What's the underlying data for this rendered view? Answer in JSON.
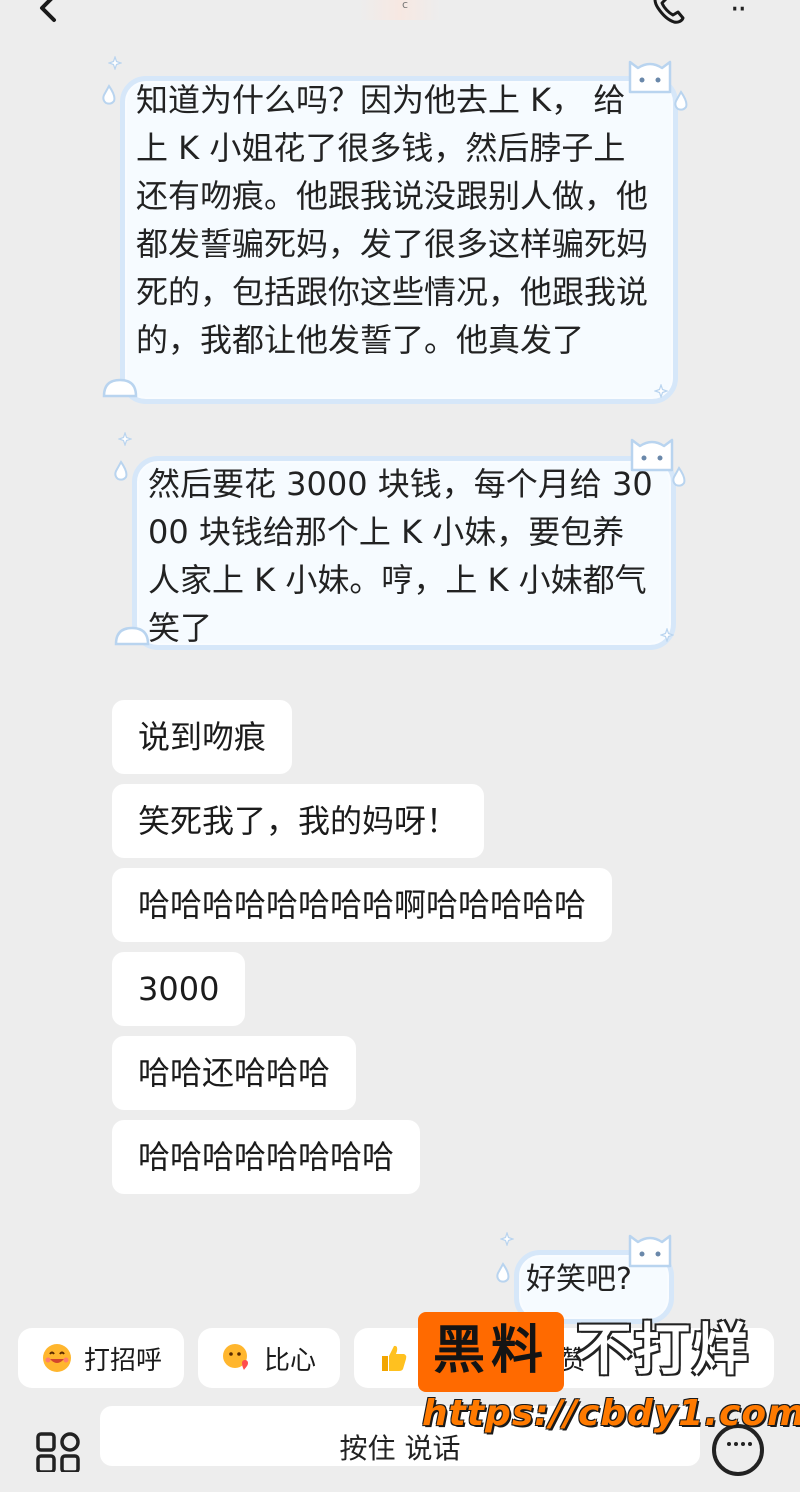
{
  "header": {
    "back_icon": "chevron-left-icon",
    "title_fragment": "c",
    "call_icon": "phone-icon",
    "more_icon": "more-dots-icon",
    "more_text": "··"
  },
  "messages": {
    "received_decorated": [
      "知道为什么吗？因为他去上 K， 给上 K 小姐花了很多钱，然后脖子上还有吻痕。他跟我说没跟别人做，他都发誓骗死妈，发了很多这样骗死妈死的，包括跟你这些情况，他跟我说的，我都让他发誓了。他真发了",
      "然后要花 3000 块钱，每个月给 3000 块钱给那个上 K 小妹，要包养人家上 K 小妹。哼，上 K 小妹都气笑了"
    ],
    "received_plain": [
      "说到吻痕",
      "笑死我了，我的妈呀！",
      "哈哈哈哈哈哈哈哈啊哈哈哈哈哈",
      "3000",
      "哈哈还哈哈哈",
      "哈哈哈哈哈哈哈哈"
    ],
    "sent_decorated": "好笑吧?"
  },
  "quick_replies": [
    {
      "icon": "grin-emoji-icon",
      "label": "打招呼"
    },
    {
      "icon": "heart-hands-emoji-icon",
      "label": "比心"
    },
    {
      "icon": "thumbs-up-emoji-icon",
      "label": "赞"
    }
  ],
  "input_bar": {
    "left_icon": "apps-grid-icon",
    "hold_to_talk": "按住 说话",
    "right_icon": "keyboard-icon"
  },
  "watermark": {
    "box_text": "黑料",
    "right_text": "不打烊",
    "url": "https://cbdy1.com"
  },
  "colors": {
    "background": "#ededed",
    "bubble": "#ffffff",
    "deco_bubble_fill": "#f6fbff",
    "deco_bubble_border": "#d6e7f9",
    "watermark_orange": "#ff6a00"
  }
}
